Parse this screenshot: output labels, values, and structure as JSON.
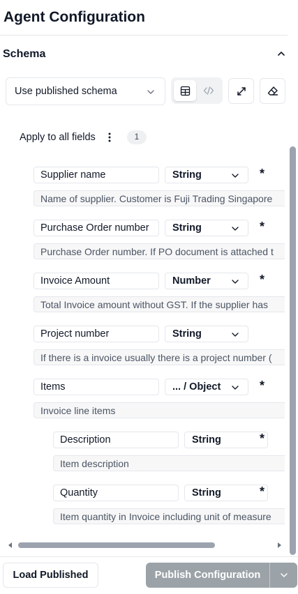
{
  "page_title": "Agent Configuration",
  "section": {
    "title": "Schema"
  },
  "schema_select": {
    "value": "Use published schema"
  },
  "apply": {
    "label": "Apply to all fields",
    "count": "1"
  },
  "fields": [
    {
      "name": "Supplier name",
      "type": "String",
      "required": "*",
      "description": "Name of supplier. Customer is Fuji Trading Singapore"
    },
    {
      "name": "Purchase Order number",
      "type": "String",
      "required": "*",
      "description": "Purchase Order number. If PO document is attached t"
    },
    {
      "name": "Invoice Amount",
      "type": "Number",
      "required": "*",
      "description": "Total Invoice amount without GST. If the supplier has"
    },
    {
      "name": "Project number",
      "type": "String",
      "required": "",
      "description": "If there is a invoice usually there is a project number ("
    },
    {
      "name": "Items",
      "type": "... / Object",
      "required": "*",
      "description": "Invoice line items"
    }
  ],
  "subfields": [
    {
      "name": "Description",
      "type": "String",
      "required": "*",
      "description": "Item description"
    },
    {
      "name": "Quantity",
      "type": "String",
      "required": "*",
      "description": "Item quantity in Invoice including unit of measure"
    }
  ],
  "footer": {
    "load_label": "Load Published",
    "publish_label": "Publish Configuration"
  },
  "icons": {
    "collapse": "chevron-up-icon",
    "select": "chevron-down-icon",
    "table_view": "table-icon",
    "code_view": "code-icon",
    "expand": "expand-icon",
    "clear": "eraser-icon",
    "more": "kebab-icon"
  },
  "colors": {
    "publish_button": "#9ca3a8",
    "text": "#111827",
    "muted_text": "#4b5563",
    "border": "#e5e7eb"
  }
}
